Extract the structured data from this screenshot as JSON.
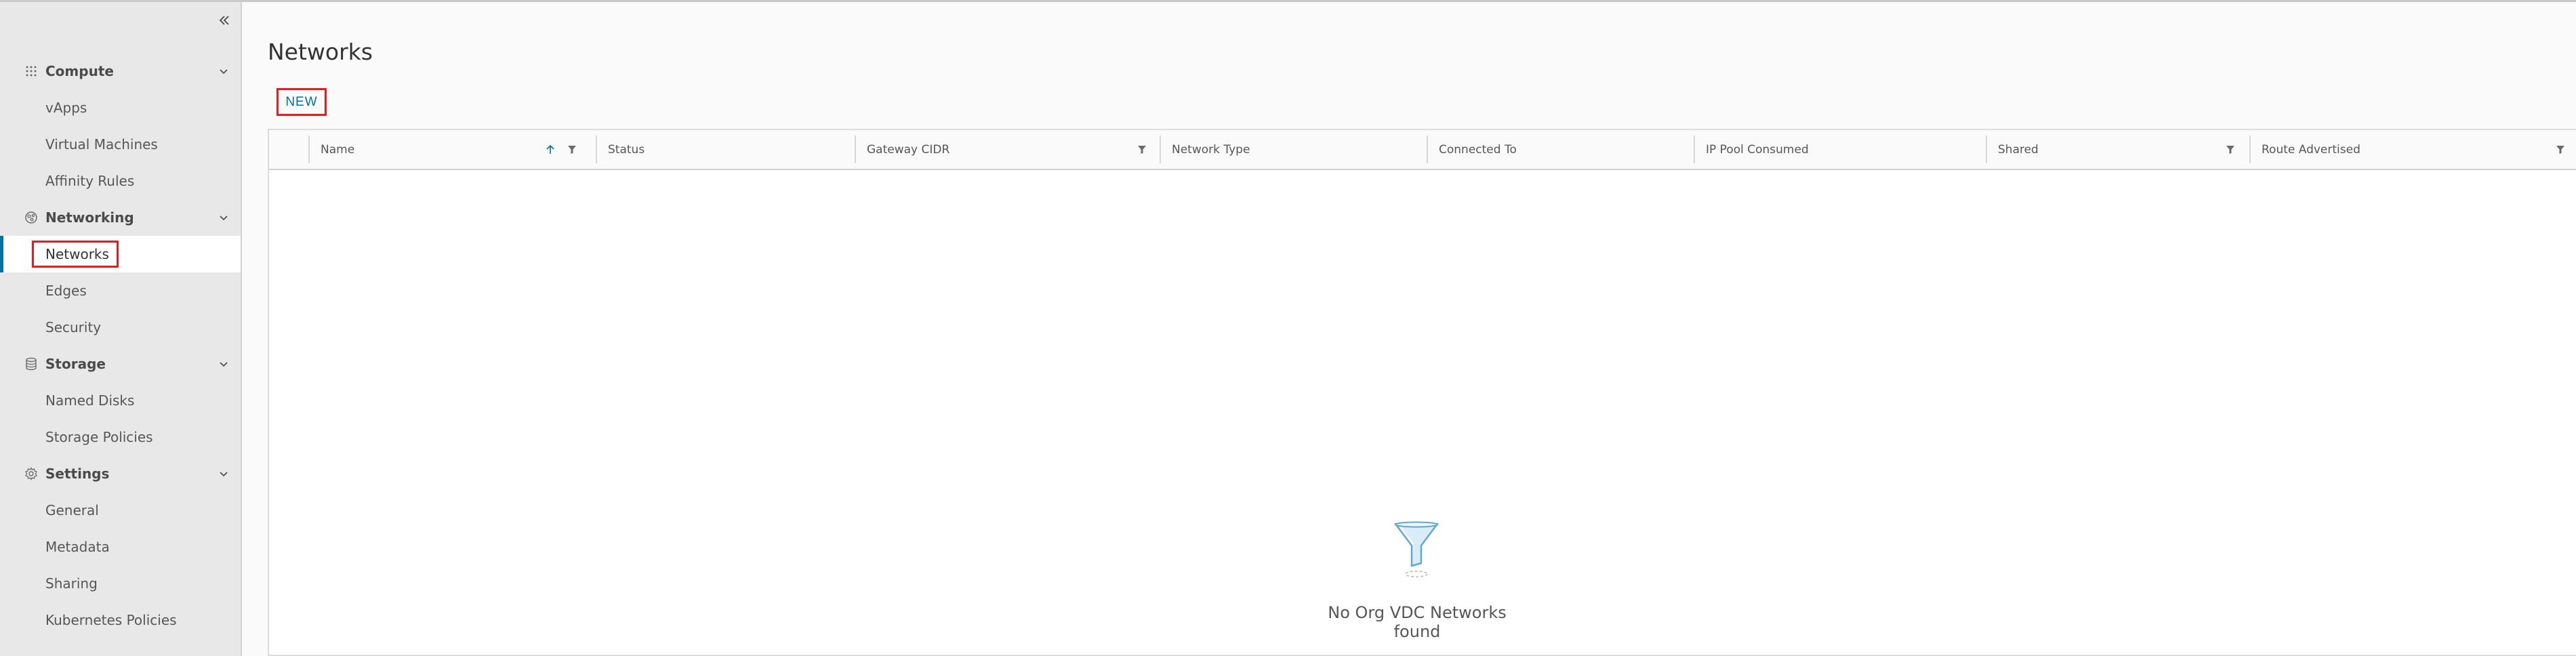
{
  "sidebar": {
    "collapse_icon": "double-chevron-left-icon",
    "groups": [
      {
        "label": "Compute",
        "icon": "grid-icon",
        "items": [
          "vApps",
          "Virtual Machines",
          "Affinity Rules"
        ]
      },
      {
        "label": "Networking",
        "icon": "network-icon",
        "items": [
          "Networks",
          "Edges",
          "Security"
        ]
      },
      {
        "label": "Storage",
        "icon": "database-icon",
        "items": [
          "Named Disks",
          "Storage Policies"
        ]
      },
      {
        "label": "Settings",
        "icon": "gear-icon",
        "items": [
          "General",
          "Metadata",
          "Sharing",
          "Kubernetes Policies"
        ]
      }
    ],
    "active_item": "Networks"
  },
  "page": {
    "title": "Networks",
    "new_button": "NEW"
  },
  "grid": {
    "columns": [
      "Name",
      "Status",
      "Gateway CIDR",
      "Network Type",
      "Connected To",
      "IP Pool Consumed",
      "Shared",
      "Route Advertised"
    ],
    "sort": {
      "column": "Name",
      "direction": "ascending"
    },
    "filterable_columns": [
      "Name",
      "Gateway CIDR",
      "Shared",
      "Route Advertised"
    ],
    "empty_message": "No Org VDC Networks found",
    "empty_icon": "funnel-icon"
  },
  "colors": {
    "accent": "#0072a3",
    "highlight": "#e02020",
    "sidebar_bg": "#e8e8e8"
  }
}
